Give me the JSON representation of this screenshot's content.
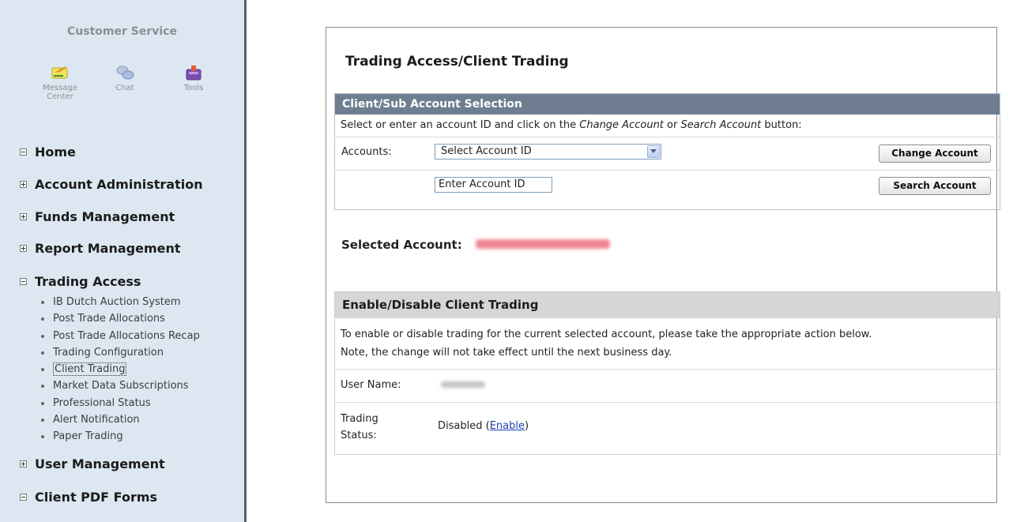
{
  "sidebar": {
    "customer_service": "Customer Service",
    "tools": [
      {
        "label_line1": "Message",
        "label_line2": "Center",
        "icon": "message-center-icon"
      },
      {
        "label_line1": "Chat",
        "label_line2": "",
        "icon": "chat-icon"
      },
      {
        "label_line1": "Tools",
        "label_line2": "",
        "icon": "tools-icon"
      }
    ],
    "nav": [
      {
        "label": "Home",
        "expanded": true
      },
      {
        "label": "Account Administration",
        "expanded": false
      },
      {
        "label": "Funds Management",
        "expanded": false
      },
      {
        "label": "Report Management",
        "expanded": false
      },
      {
        "label": "Trading Access",
        "expanded": true
      },
      {
        "label": "User Management",
        "expanded": false
      },
      {
        "label": "Client PDF Forms",
        "expanded": true
      }
    ],
    "trading_access_items": [
      "IB Dutch Auction System",
      "Post Trade Allocations",
      "Post Trade Allocations Recap",
      "Trading Configuration",
      "Client Trading",
      "Market Data Subscriptions",
      "Professional Status",
      "Alert Notification",
      "Paper Trading"
    ],
    "active_item": "Client Trading"
  },
  "main": {
    "title": "Trading Access/Client Trading",
    "selection": {
      "header": "Client/Sub Account Selection",
      "instruction_prefix": "Select or enter an account ID and click on the ",
      "instruction_change": "Change Account",
      "instruction_or": " or ",
      "instruction_search": "Search Account",
      "instruction_suffix": " button:",
      "accounts_label": "Accounts:",
      "select_value": "Select Account ID",
      "input_value": "Enter Account ID",
      "change_button": "Change Account",
      "search_button": "Search Account"
    },
    "selected_account_label": "Selected Account:",
    "enable_section": {
      "header": "Enable/Disable Client Trading",
      "desc_line1": "To enable or disable trading for the current selected account, please take the appropriate action below.",
      "desc_line2": "Note, the change will not take effect until the next business day.",
      "user_name_label": "User Name:",
      "trading_label_line1": "Trading",
      "trading_label_line2": "Status:",
      "status_value": "Disabled (",
      "enable_link": "Enable",
      "status_close": ")"
    }
  },
  "colors": {
    "sidebar_bg": "#dde7f1",
    "section_header": "#6e7e90",
    "section2_header": "#d6d6d6",
    "link": "#1f3fb8",
    "redaction": "#e8707e"
  }
}
